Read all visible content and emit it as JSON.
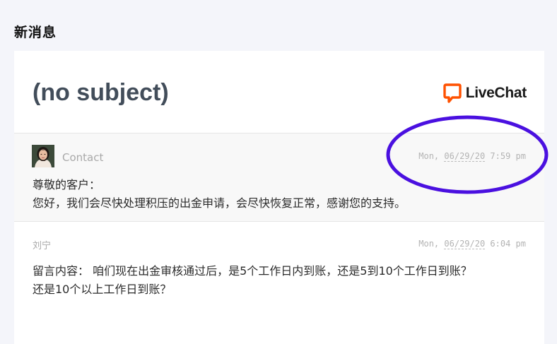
{
  "page": {
    "title": "新消息"
  },
  "email": {
    "subject": "(no subject)",
    "brand": {
      "name": "LiveChat",
      "accent": "#ff5100"
    },
    "messages": [
      {
        "sender": "Contact",
        "timestamp": {
          "day": "Mon,",
          "date": "06/29/20",
          "time": "7:59 pm"
        },
        "lines": [
          "尊敬的客户：",
          "您好，我们会尽快处理积压的出金申请，会尽快恢复正常，感谢您的支持。"
        ]
      },
      {
        "sender": "刘宁",
        "timestamp": {
          "day": "Mon,",
          "date": "06/29/20",
          "time": "6:04 pm"
        },
        "lines": [
          "留言内容： 咱们现在出金审核通过后，是5个工作日内到账，还是5到10个工作日到账？",
          "还是10个以上工作日到账？"
        ]
      }
    ]
  },
  "annotation": {
    "color": "#4a10e0"
  }
}
